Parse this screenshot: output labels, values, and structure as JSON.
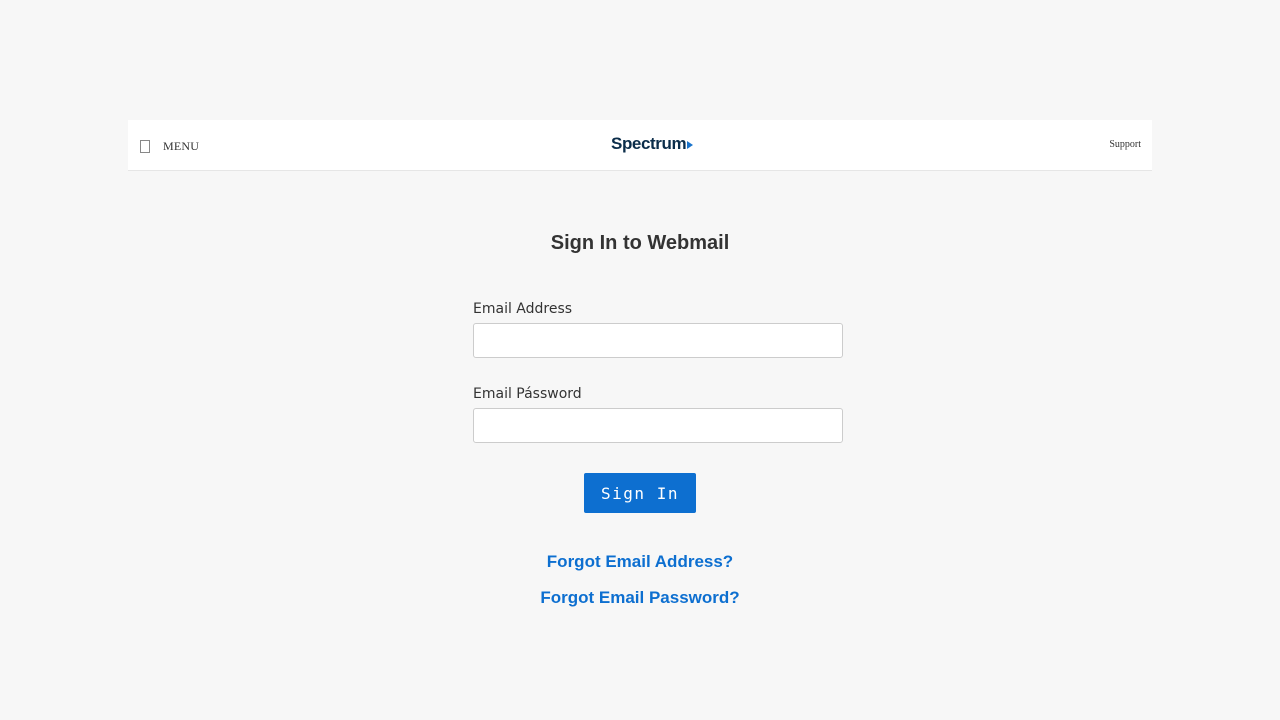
{
  "header": {
    "menu_label": "MENU",
    "logo_text": "Spectrum",
    "support_label": "Support"
  },
  "page": {
    "title": "Sign In to Webmail"
  },
  "form": {
    "email_label": "Email Address",
    "email_value": "",
    "password_label": "Email Pássword",
    "password_value": "",
    "submit_label": "Sign In"
  },
  "links": {
    "forgot_email": "Forgot Email Address?",
    "forgot_password": "Forgot Email Password?"
  },
  "colors": {
    "background": "#f7f7f7",
    "accent": "#0d6fd0",
    "logo_text": "#0b2d4a",
    "logo_arrow": "#1a74cc"
  },
  "icons": {
    "menu": "menu-icon",
    "logo_play": "play-arrow-icon"
  }
}
